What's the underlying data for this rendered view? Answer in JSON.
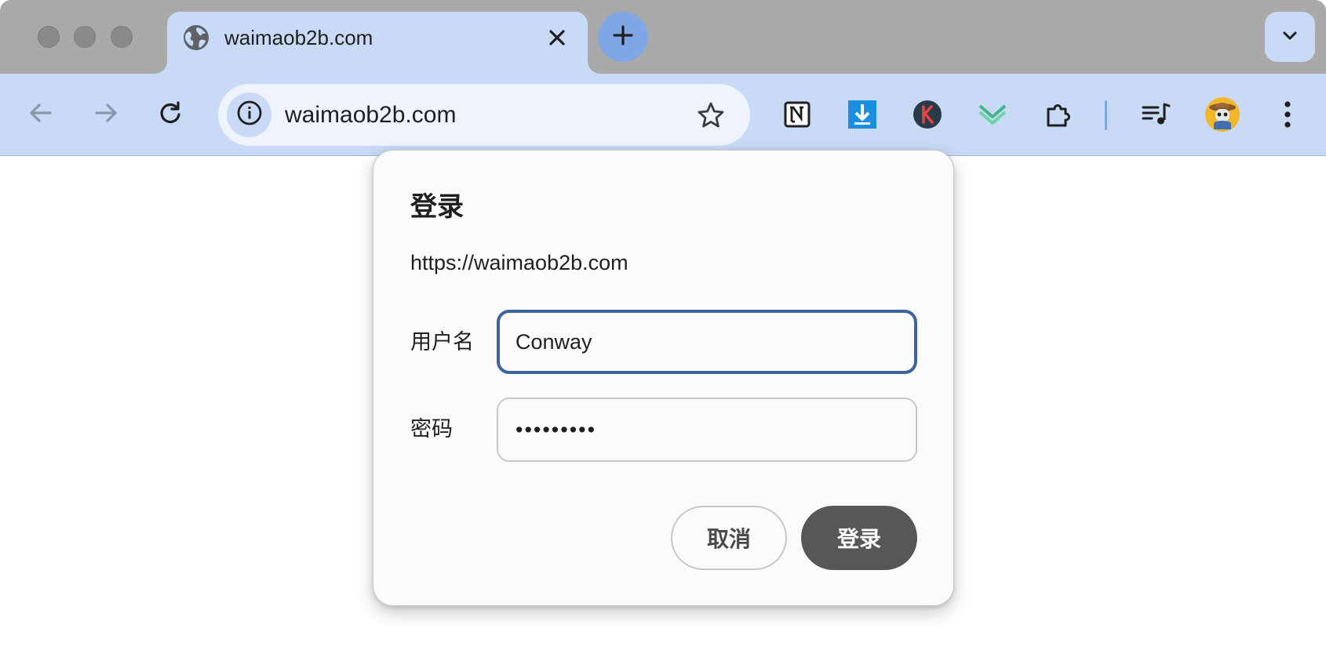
{
  "tab": {
    "title": "waimaob2b.com",
    "favicon_icon": "globe-icon",
    "close_icon": "close-icon"
  },
  "toolbar": {
    "url": "waimaob2b.com",
    "back_icon": "arrow-left-icon",
    "forward_icon": "arrow-right-icon",
    "reload_icon": "reload-icon",
    "site_info_icon": "info-icon",
    "bookmark_icon": "star-icon",
    "extensions": [
      "notion-icon",
      "download-icon",
      "k-extension-icon",
      "chevron-stack-icon",
      "puzzle-icon",
      "media-queue-icon",
      "avatar-icon",
      "more-vertical-icon"
    ]
  },
  "dialog": {
    "title": "登录",
    "origin": "https://waimaob2b.com",
    "username_label": "用户名",
    "username_value": "Conway",
    "password_label": "密码",
    "password_value": "•••••••••",
    "cancel_label": "取消",
    "login_label": "登录"
  },
  "colors": {
    "tab_strip": "#a9a9a9",
    "toolbar": "#c9daf6",
    "focus_ring": "#3d639e",
    "primary_button": "#575757"
  }
}
